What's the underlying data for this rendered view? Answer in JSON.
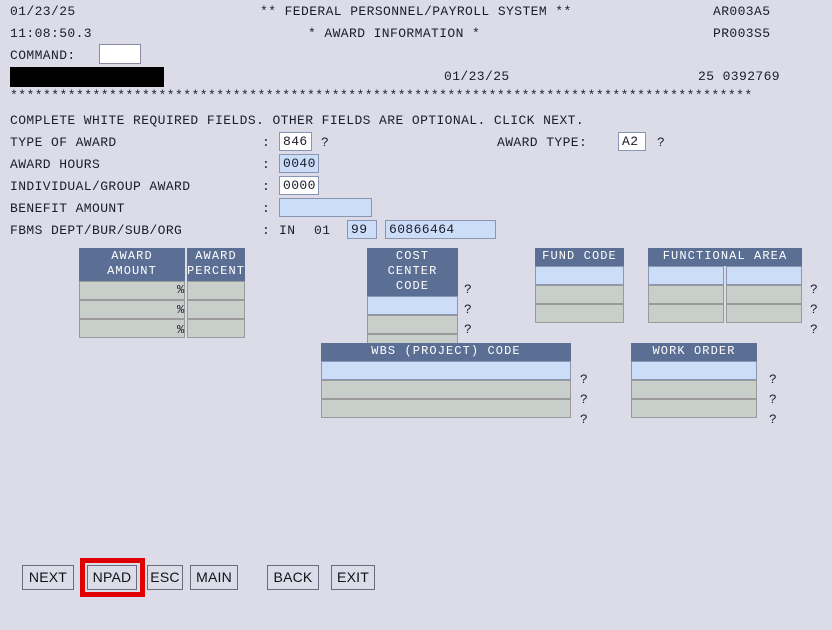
{
  "header": {
    "date": "01/23/25",
    "time": "11:08:50.3",
    "title_line1": "** FEDERAL PERSONNEL/PAYROLL SYSTEM **",
    "title_line2": "* AWARD INFORMATION *",
    "screen_code": "AR003A5",
    "program_code": "PR003S5",
    "command_label": "COMMAND:",
    "command_value": "",
    "effective_date": "01/23/25",
    "reference_number": "25 0392769",
    "separator": "******************************************************************************************"
  },
  "instruction": "COMPLETE WHITE REQUIRED FIELDS. OTHER FIELDS ARE OPTIONAL. CLICK NEXT.",
  "form": {
    "colon": ":",
    "question_mark": "?",
    "percent_symbol": "%",
    "type_of_award": {
      "label": "TYPE OF AWARD",
      "value": "846",
      "required": true
    },
    "award_hours": {
      "label": "AWARD HOURS",
      "value": "0040",
      "required": false
    },
    "individual_group_award": {
      "label": "INDIVIDUAL/GROUP AWARD",
      "value": "0000",
      "required": true
    },
    "benefit_amount": {
      "label": "BENEFIT AMOUNT",
      "value": "",
      "required": false
    },
    "fbms": {
      "label": "FBMS DEPT/BUR/SUB/ORG",
      "dept": "IN",
      "bur": "01",
      "sub": "99",
      "org": "60866464"
    },
    "award_type": {
      "label": "AWARD TYPE:",
      "value": "A2",
      "required": true
    }
  },
  "tables": {
    "award": {
      "header_amount": "AWARD\nAMOUNT",
      "header_percent": "AWARD\nPERCENT",
      "rows": [
        {
          "amount": "",
          "percent": "",
          "active": false
        },
        {
          "amount": "",
          "percent": "",
          "active": false
        },
        {
          "amount": "",
          "percent": "",
          "active": false
        }
      ]
    },
    "cost_center_code": {
      "header": "COST CENTER\nCODE",
      "rows": [
        {
          "value": "",
          "active": true
        },
        {
          "value": "",
          "active": false
        },
        {
          "value": "",
          "active": false
        }
      ]
    },
    "fund_code": {
      "header": "FUND CODE",
      "rows": [
        {
          "value": "",
          "active": true
        },
        {
          "value": "",
          "active": false
        },
        {
          "value": "",
          "active": false
        }
      ]
    },
    "functional_area": {
      "header": "FUNCTIONAL AREA",
      "rows": [
        {
          "left": "",
          "right": "",
          "active": true
        },
        {
          "left": "",
          "right": "",
          "active": false
        },
        {
          "left": "",
          "right": "",
          "active": false
        }
      ]
    },
    "wbs_project_code": {
      "header": "WBS (PROJECT) CODE",
      "rows": [
        {
          "value": "",
          "active": true
        },
        {
          "value": "",
          "active": false
        },
        {
          "value": "",
          "active": false
        }
      ]
    },
    "work_order": {
      "header": "WORK ORDER",
      "rows": [
        {
          "value": "",
          "active": true
        },
        {
          "value": "",
          "active": false
        },
        {
          "value": "",
          "active": false
        }
      ]
    }
  },
  "buttons": {
    "next": "NEXT",
    "npad": "NPAD",
    "esc": "ESC",
    "main": "MAIN",
    "back": "BACK",
    "exit": "EXIT",
    "highlighted": "NPAD"
  },
  "colors": {
    "background": "#dcdce8",
    "table_header": "#5b6e93",
    "active_field": "#ccddf7",
    "disabled_field": "#c8cfcb",
    "required_field": "#ffffff",
    "highlight_border": "#e00000"
  }
}
